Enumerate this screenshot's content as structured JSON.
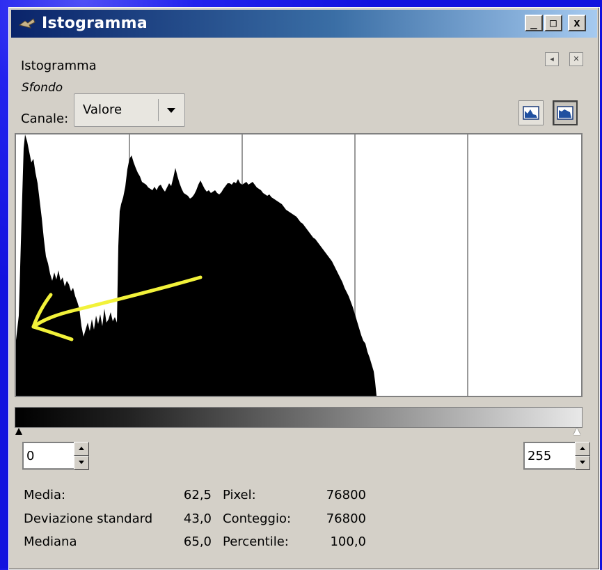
{
  "window": {
    "title": "Istogramma",
    "buttons": {
      "minimize": "_",
      "maximize": "□",
      "close": "x"
    }
  },
  "panel": {
    "header": "Istogramma",
    "layer": "Sfondo",
    "channel_label": "Canale:",
    "channel_value": "Valore",
    "channel_icon": "chevron-down-icon",
    "view_modes": [
      "linear-histogram-icon",
      "logarithmic-histogram-icon"
    ]
  },
  "range": {
    "start": "0",
    "end": "255"
  },
  "stats": {
    "rows": [
      {
        "label": "Media:",
        "value": "62,5",
        "label2": "Pixel:",
        "value2": "76800"
      },
      {
        "label": "Deviazione standard",
        "value": "43,0",
        "label2": "Conteggio:",
        "value2": "76800"
      },
      {
        "label": "Mediana",
        "value": "65,0",
        "label2": "Percentile:",
        "value2": "100,0"
      }
    ]
  },
  "annotation": {
    "color": "#f2f23a",
    "type": "arrow-pointing-left"
  },
  "colors": {
    "window_bg": "#d4d0c8",
    "titlebar": "#0a246a",
    "desktop": "#1a1ae6"
  }
}
